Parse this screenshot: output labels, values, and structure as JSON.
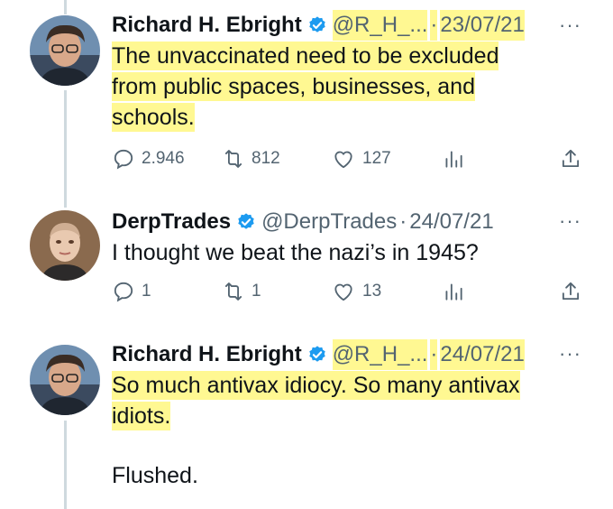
{
  "tweets": [
    {
      "name": "Richard H. Ebright",
      "handle": "@R_H_...",
      "separator": "·",
      "date": "23/07/21",
      "text_lines": [
        "The unvaccinated need to be excluded",
        "from public spaces, businesses, and",
        "schools."
      ],
      "replies": "2.946",
      "retweets": "812",
      "likes": "127",
      "more_icon": "more-dots-icon",
      "highlight_color": "#fff66e"
    },
    {
      "name": "DerpTrades",
      "handle": "@DerpTrades",
      "separator": "·",
      "date": "24/07/21",
      "text_lines": [
        "I thought we beat the nazi’s in 1945?"
      ],
      "replies": "1",
      "retweets": "1",
      "likes": "13",
      "more_icon": "more-dots-icon"
    },
    {
      "name": "Richard H. Ebright",
      "handle": "@R_H_...",
      "separator": "·",
      "date": "24/07/21",
      "text_lines": [
        "So much antivax idiocy. So many antivax",
        "idiots.",
        "Flushed."
      ],
      "more_icon": "more-dots-icon",
      "highlight_color": "#fff66e"
    }
  ],
  "colors": {
    "verified": "#1d9bf0",
    "muted": "#536471",
    "thread_line": "#cfd9de"
  }
}
